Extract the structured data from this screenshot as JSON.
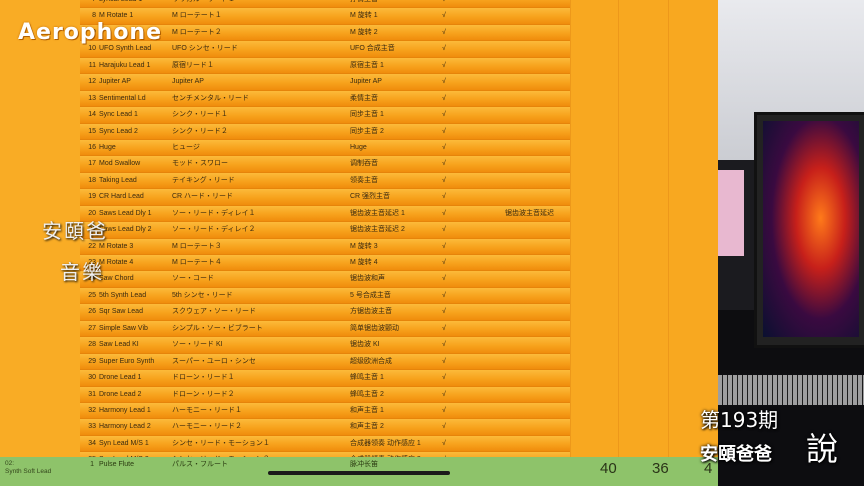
{
  "logo": "Aerophone",
  "table_rows": [
    {
      "num": "7",
      "name": "Lyrical Lead 1",
      "jp": "リリカル・リード１",
      "cn": "抒情主音",
      "mark": "√",
      "extra": ""
    },
    {
      "num": "8",
      "name": "M Rotate 1",
      "jp": "M ローテート１",
      "cn": "M 旋转 1",
      "mark": "√",
      "extra": ""
    },
    {
      "num": "9",
      "name": "",
      "jp": "M ローテート２",
      "cn": "M 旋转 2",
      "mark": "√",
      "extra": ""
    },
    {
      "num": "10",
      "name": "UFO Synth Lead",
      "jp": "UFO シンセ・リード",
      "cn": "UFO 合成主音",
      "mark": "√",
      "extra": ""
    },
    {
      "num": "11",
      "name": "Harajuku Lead 1",
      "jp": "原宿リード１",
      "cn": "原宿主音 1",
      "mark": "√",
      "extra": ""
    },
    {
      "num": "12",
      "name": "Jupiter AP",
      "jp": "Jupiter AP",
      "cn": "Jupiter AP",
      "mark": "√",
      "extra": ""
    },
    {
      "num": "13",
      "name": "Sentimental Ld",
      "jp": "センチメンタル・リード",
      "cn": "柔情主音",
      "mark": "√",
      "extra": ""
    },
    {
      "num": "14",
      "name": "Sync Lead 1",
      "jp": "シンク・リード１",
      "cn": "同步主音 1",
      "mark": "√",
      "extra": ""
    },
    {
      "num": "15",
      "name": "Sync Lead 2",
      "jp": "シンク・リード２",
      "cn": "同步主音 2",
      "mark": "√",
      "extra": ""
    },
    {
      "num": "16",
      "name": "Huge",
      "jp": "ヒュージ",
      "cn": "Huge",
      "mark": "√",
      "extra": ""
    },
    {
      "num": "17",
      "name": "Mod Swallow",
      "jp": "モッド・スワロー",
      "cn": "调制吞音",
      "mark": "√",
      "extra": ""
    },
    {
      "num": "18",
      "name": "Taking Lead",
      "jp": "テイキング・リード",
      "cn": "领奏主音",
      "mark": "√",
      "extra": ""
    },
    {
      "num": "19",
      "name": "CR Hard Lead",
      "jp": "CR ハード・リード",
      "cn": "CR 强烈主音",
      "mark": "√",
      "extra": ""
    },
    {
      "num": "20",
      "name": "Saws Lead Dly 1",
      "jp": "ソー・リード・ディレイ１",
      "cn": "锯齿波主音延迟 1",
      "mark": "√",
      "extra": "锯齿波主音延迟"
    },
    {
      "num": "21",
      "name": "Saws Lead Dly 2",
      "jp": "ソー・リード・ディレイ２",
      "cn": "锯齿波主音延迟 2",
      "mark": "√",
      "extra": ""
    },
    {
      "num": "22",
      "name": "M Rotate 3",
      "jp": "M ローテート３",
      "cn": "M 旋转 3",
      "mark": "√",
      "extra": ""
    },
    {
      "num": "23",
      "name": "M Rotate 4",
      "jp": "M ローテート４",
      "cn": "M 旋转 4",
      "mark": "√",
      "extra": ""
    },
    {
      "num": "24",
      "name": "Saw Chord",
      "jp": "ソー・コード",
      "cn": "锯齿波和声",
      "mark": "√",
      "extra": ""
    },
    {
      "num": "25",
      "name": "5th Synth Lead",
      "jp": "5th シンセ・リード",
      "cn": "5 号合成主音",
      "mark": "√",
      "extra": ""
    },
    {
      "num": "26",
      "name": "Sqr Saw Lead",
      "jp": "スクウェア・ソー・リード",
      "cn": "方锯齿波主音",
      "mark": "√",
      "extra": ""
    },
    {
      "num": "27",
      "name": "Simple Saw Vib",
      "jp": "シンプル・ソー・ビブラート",
      "cn": "简单锯齿波颤动",
      "mark": "√",
      "extra": ""
    },
    {
      "num": "28",
      "name": "Saw Lead KI",
      "jp": "ソー・リード KI",
      "cn": "锯齿波 KI",
      "mark": "√",
      "extra": ""
    },
    {
      "num": "29",
      "name": "Super Euro Synth",
      "jp": "スーパー・ユーロ・シンセ",
      "cn": "超级欧洲合成",
      "mark": "√",
      "extra": ""
    },
    {
      "num": "30",
      "name": "Drone Lead 1",
      "jp": "ドローン・リード１",
      "cn": "蜂鸣主音 1",
      "mark": "√",
      "extra": ""
    },
    {
      "num": "31",
      "name": "Drone Lead 2",
      "jp": "ドローン・リード２",
      "cn": "蜂鸣主音 2",
      "mark": "√",
      "extra": ""
    },
    {
      "num": "32",
      "name": "Harmony Lead 1",
      "jp": "ハーモニー・リード１",
      "cn": "和声主音 1",
      "mark": "√",
      "extra": ""
    },
    {
      "num": "33",
      "name": "Harmony Lead 2",
      "jp": "ハーモニー・リード２",
      "cn": "和声主音 2",
      "mark": "√",
      "extra": ""
    },
    {
      "num": "34",
      "name": "Syn Lead M/S 1",
      "jp": "シンセ・リード・モーション１",
      "cn": "合成器领奏 动作感应 1",
      "mark": "√",
      "extra": ""
    },
    {
      "num": "35",
      "name": "Syn Lead M/S 2",
      "jp": "シンセ・リード・モーション２",
      "cn": "合成器领奏 动作感应 2",
      "mark": "√",
      "extra": ""
    },
    {
      "num": "36",
      "name": "Syn Lead M/S 3",
      "jp": "シンセ・リード・モーション３",
      "cn": "合成器领奏 动作感应 3",
      "mark": "√",
      "extra": ""
    }
  ],
  "bottom": {
    "section_label_1": "02:",
    "section_label_2": "Synth Soft Lead",
    "num": "1",
    "name": "Pulse Flute",
    "jp": "パルス・フルート",
    "cn": "脉冲长笛",
    "count_1": "40",
    "count_2": "36",
    "count_3": "4"
  },
  "overlay": {
    "brand_cn_1": "安頤爸",
    "brand_cn_2": "音樂",
    "episode": "第193期",
    "show_title": "安頤爸爸",
    "show_say": "說"
  },
  "colors": {
    "row_orange": "#f7a21c",
    "bottom_green": "#8ec36a"
  }
}
